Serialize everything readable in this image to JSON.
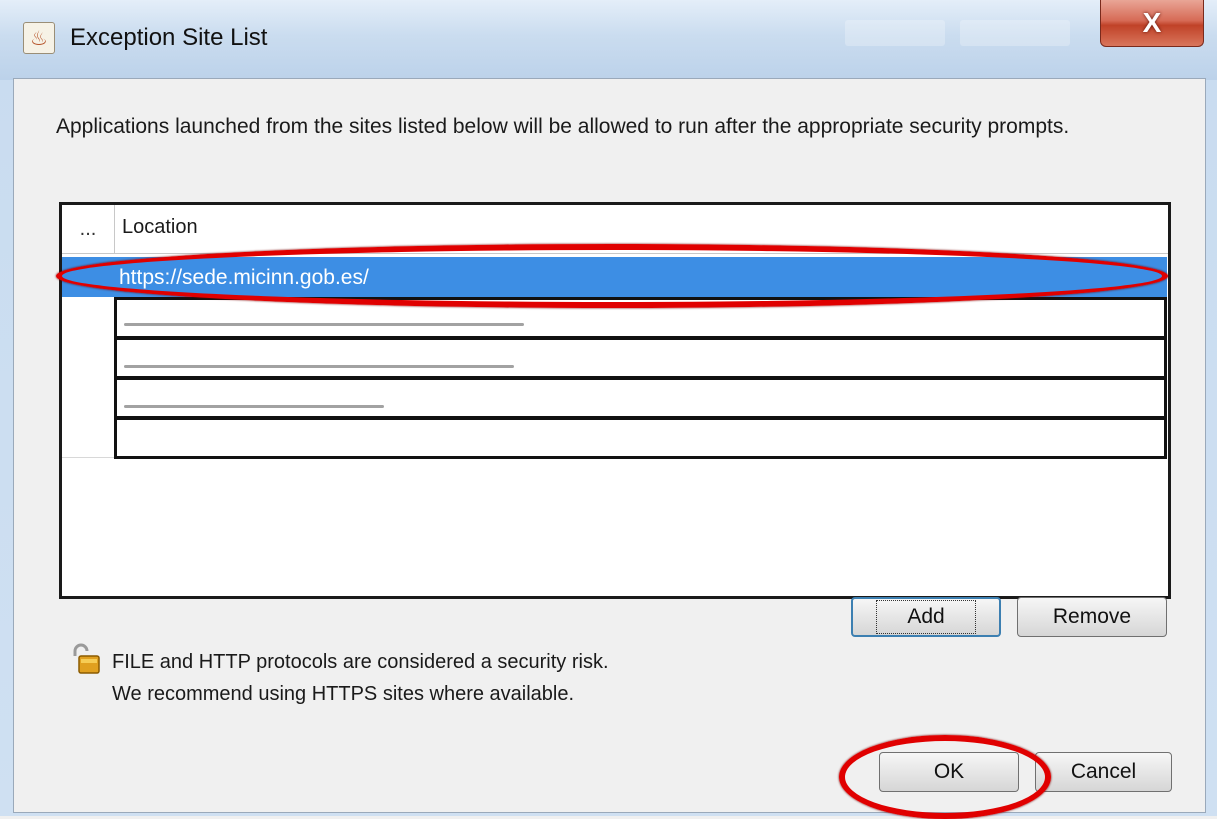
{
  "window": {
    "title": "Exception Site List",
    "close_label": "X"
  },
  "description": "Applications launched from the sites listed below will be allowed to run after the appropriate security prompts.",
  "table": {
    "columns": [
      "...",
      "Location"
    ],
    "rows": [
      {
        "location": "https://sede.micinn.gob.es/",
        "selected": true
      },
      {
        "location": "",
        "selected": false
      },
      {
        "location": "",
        "selected": false
      },
      {
        "location": "",
        "selected": false
      },
      {
        "location": "",
        "selected": false
      }
    ]
  },
  "buttons": {
    "add": "Add",
    "remove": "Remove",
    "ok": "OK",
    "cancel": "Cancel"
  },
  "security_note": {
    "line1": "FILE and HTTP protocols are considered a security risk.",
    "line2": "We recommend using HTTPS sites where available."
  },
  "icons": {
    "app": "java-icon",
    "note": "unlocked-padlock-icon"
  },
  "colors": {
    "selection": "#3d8ee4",
    "annotation": "#e00000"
  }
}
